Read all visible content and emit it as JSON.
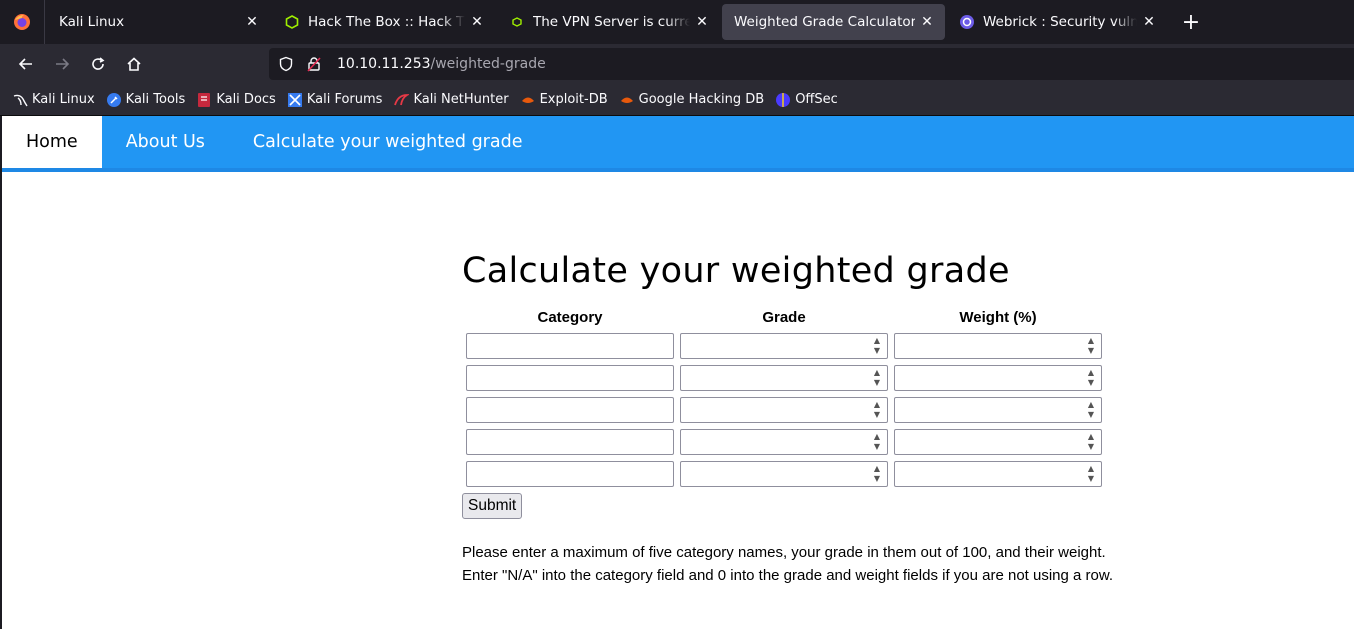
{
  "browser": {
    "tabs": [
      {
        "title": "Kali Linux",
        "icon": "kali-icon",
        "active": false
      },
      {
        "title": "Hack The Box :: Hack The Box",
        "icon": "htb-cube-icon",
        "active": false
      },
      {
        "title": "The VPN Server is currently",
        "icon": "htb-small-icon",
        "active": false
      },
      {
        "title": "Weighted Grade Calculator",
        "icon": "",
        "active": true
      },
      {
        "title": "Webrick : Security vulnerab",
        "icon": "webrick-icon",
        "active": false
      }
    ],
    "new_tab_label": "+",
    "url_host": "10.10.11.253",
    "url_path": "/weighted-grade",
    "bookmarks": [
      {
        "label": "Kali Linux",
        "icon": "kali-dragon-icon"
      },
      {
        "label": "Kali Tools",
        "icon": "kali-tools-icon"
      },
      {
        "label": "Kali Docs",
        "icon": "kali-docs-icon"
      },
      {
        "label": "Kali Forums",
        "icon": "kali-forums-icon"
      },
      {
        "label": "Kali NetHunter",
        "icon": "nethunter-icon"
      },
      {
        "label": "Exploit-DB",
        "icon": "exploitdb-icon"
      },
      {
        "label": "Google Hacking DB",
        "icon": "ghdb-icon"
      },
      {
        "label": "OffSec",
        "icon": "offsec-icon"
      }
    ]
  },
  "nav": {
    "items": [
      {
        "label": "Home",
        "active": true
      },
      {
        "label": "About Us",
        "active": false
      },
      {
        "label": "Calculate your weighted grade",
        "active": false
      }
    ]
  },
  "main": {
    "title": "Calculate your weighted grade",
    "columns": [
      "Category",
      "Grade",
      "Weight (%)"
    ],
    "rows": [
      {
        "category": "",
        "grade": "",
        "weight": ""
      },
      {
        "category": "",
        "grade": "",
        "weight": ""
      },
      {
        "category": "",
        "grade": "",
        "weight": ""
      },
      {
        "category": "",
        "grade": "",
        "weight": ""
      },
      {
        "category": "",
        "grade": "",
        "weight": ""
      }
    ],
    "submit_label": "Submit",
    "help_line1": "Please enter a maximum of five category names, your grade in them out of 100, and their weight.",
    "help_line2": "Enter \"N/A\" into the category field and 0 into the grade and weight fields if you are not using a row."
  }
}
